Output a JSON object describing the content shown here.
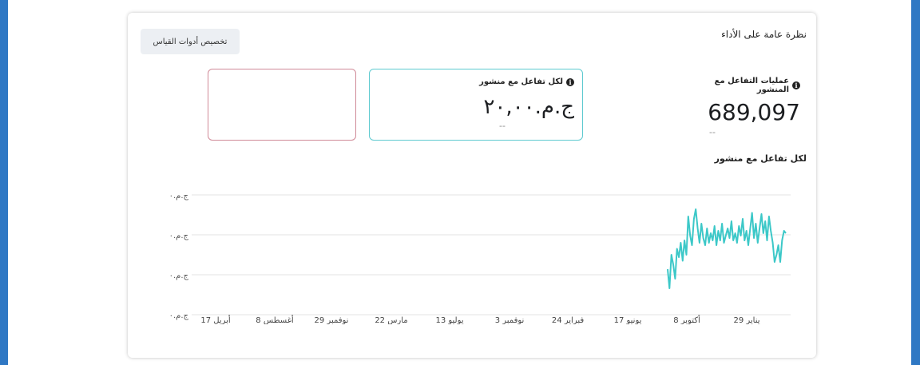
{
  "card": {
    "title": "نظرة عامة على الأداء",
    "customize_label": "تخصيص أدوات القياس"
  },
  "metrics": {
    "engagements_label": "عمليات التفاعل مع المنشور",
    "engagements_value": "689,097",
    "engagements_sub": "--",
    "cost_label": "لكل تفاعل مع منشور",
    "cost_value": "ج.م.٢٠,٠٠",
    "cost_sub": "--"
  },
  "info_icon": "info-icon",
  "chart_data": {
    "type": "line",
    "title": "لكل تفاعل مع منشور",
    "ytick_labels": [
      "ج.م.٠",
      "ج.م.٠",
      "ج.م.٠",
      "ج.م.٠"
    ],
    "xtick_labels": [
      "29 يناير",
      "8 أكتوبر",
      "17 يونيو",
      "24 فبراير",
      "3 نوفمبر",
      "13 يوليو",
      "22 مارس",
      "29 نوفمبر",
      "8 أغسطس",
      "17 أبريل"
    ],
    "series": [
      {
        "color": "#3cc8c8",
        "values": [
          0.38,
          0.22,
          0.5,
          0.42,
          0.3,
          0.55,
          0.48,
          0.6,
          0.45,
          0.62,
          0.5,
          0.82,
          0.66,
          0.58,
          0.8,
          0.88,
          0.72,
          0.6,
          0.76,
          0.64,
          0.58,
          0.72,
          0.6,
          0.68,
          0.62,
          0.74,
          0.58,
          0.7,
          0.62,
          0.76,
          0.6,
          0.66,
          0.72,
          0.64,
          0.78,
          0.62,
          0.68,
          0.6,
          0.74,
          0.66,
          0.8,
          0.62,
          0.7,
          0.58,
          0.72,
          0.85,
          0.64,
          0.76,
          0.6,
          0.72,
          0.84,
          0.68,
          0.78,
          0.62,
          0.82,
          0.7,
          0.6,
          0.44,
          0.5,
          0.58,
          0.44,
          0.62,
          0.7,
          0.68
        ]
      }
    ],
    "grid": true,
    "legend": "none"
  }
}
